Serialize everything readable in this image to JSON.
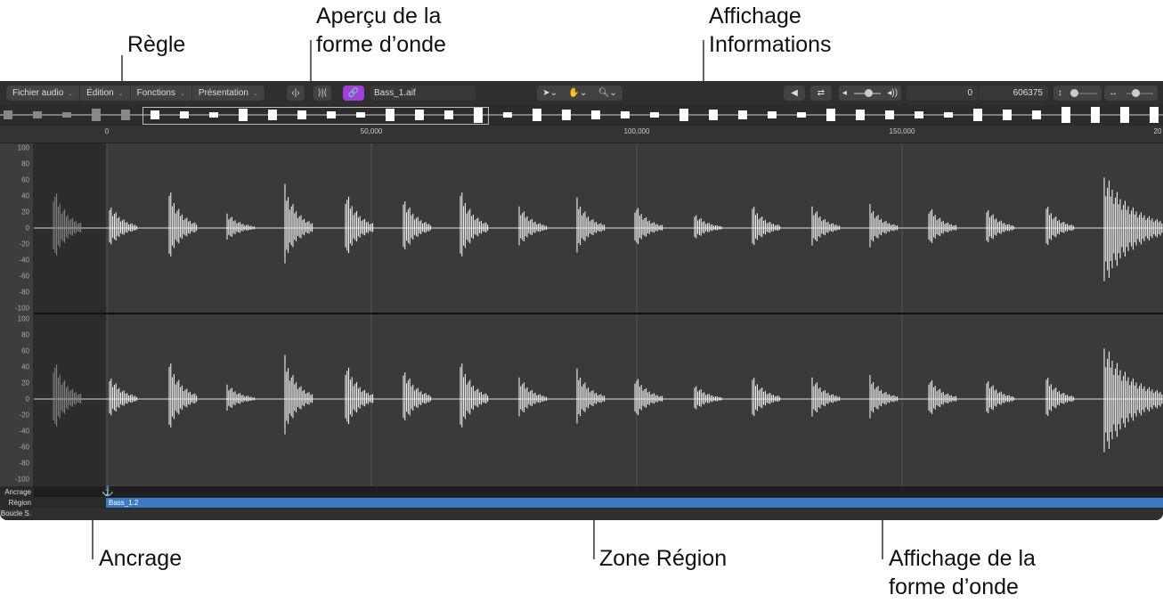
{
  "callouts": {
    "regle": "Règle",
    "apercu": "Aperçu de la\nforme d’onde",
    "affichage_info": "Affichage\nInformations",
    "ancrage": "Ancrage",
    "zone_region": "Zone Région",
    "affichage_forme": "Affichage de la\nforme d’onde"
  },
  "toolbar": {
    "menus": [
      "Fichier audio",
      "Édition",
      "Fonctions",
      "Présentation"
    ],
    "file_name": "Bass_1.aif",
    "start_value": "0",
    "end_value": "606375",
    "link_color": "#a040d8"
  },
  "ruler": {
    "labels": [
      "0",
      "50,000",
      "100,000",
      "150,000",
      "20"
    ]
  },
  "y_axis": [
    "100",
    "80",
    "60",
    "40",
    "20",
    "0",
    "-20",
    "-40",
    "-60",
    "-80",
    "-100"
  ],
  "lanes": {
    "anchor": "Ancrage",
    "region": "Région",
    "loop": "Boucle S.",
    "region_name": "Bass_1.2",
    "region_color": "#3b7bc4"
  },
  "icons": [
    "pointer-tool-icon",
    "hand-tool-icon",
    "zoom-tool-icon",
    "speaker-icon",
    "loop-icon",
    "volume-icon",
    "vertical-zoom-icon",
    "horizontal-zoom-icon",
    "anchor-icon",
    "link-icon",
    "trim-icon",
    "snap-icon"
  ]
}
